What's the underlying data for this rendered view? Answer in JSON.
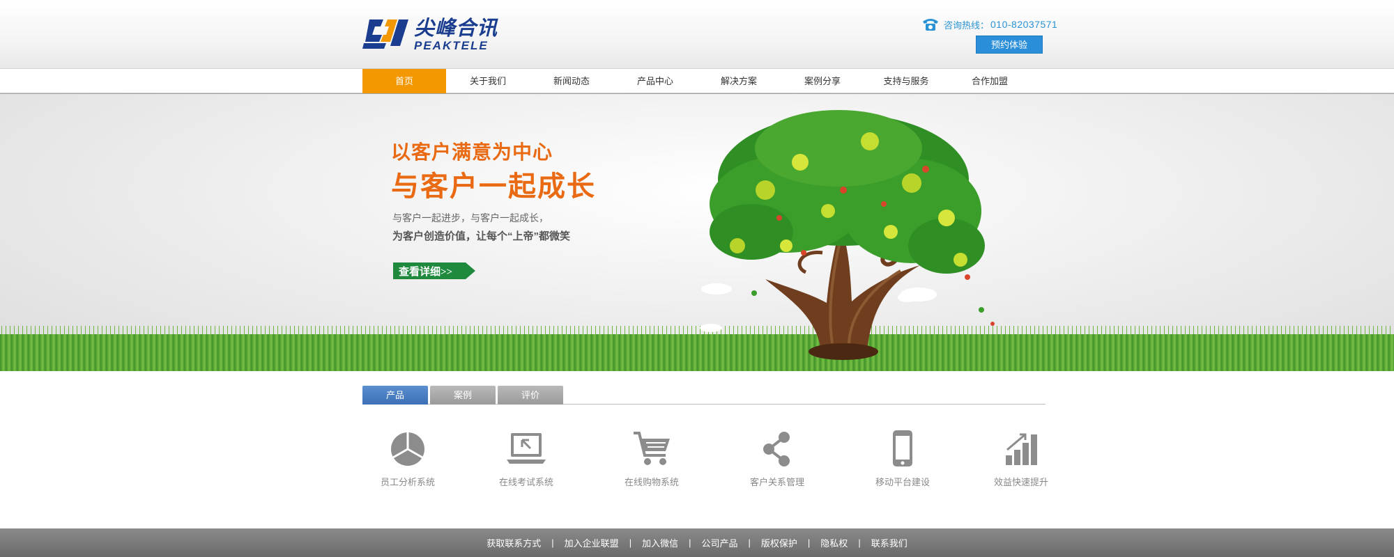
{
  "header": {
    "logo": {
      "name_cn": "尖峰合讯",
      "name_en": "PEAKTELE"
    },
    "hotline": {
      "label": "咨询热线：",
      "number": "010-82037571",
      "icon": "phone-icon"
    },
    "trial_button": "预约体验"
  },
  "nav": {
    "items": [
      {
        "label": "首页",
        "active": true
      },
      {
        "label": "关于我们"
      },
      {
        "label": "新闻动态"
      },
      {
        "label": "产品中心"
      },
      {
        "label": "解决方案"
      },
      {
        "label": "案例分享"
      },
      {
        "label": "支持与服务"
      },
      {
        "label": "合作加盟"
      }
    ]
  },
  "banner": {
    "slogan_line1": "以客户满意为中心",
    "slogan_line2": "与客户一起成长",
    "sub_line1": "与客户一起进步，与客户一起成长，",
    "sub_line2": "为客户创造价值，让每个“上帝”都微笑",
    "detail_button": "查看详细>>",
    "image": "tree-illustration"
  },
  "tabs": [
    {
      "label": "产品",
      "active": true
    },
    {
      "label": "案例"
    },
    {
      "label": "评价"
    }
  ],
  "products": [
    {
      "label": "员工分析系统",
      "icon": "pie-chart-icon"
    },
    {
      "label": "在线考试系统",
      "icon": "laptop-icon"
    },
    {
      "label": "在线购物系统",
      "icon": "shopping-cart-icon"
    },
    {
      "label": "客户关系管理",
      "icon": "share-icon"
    },
    {
      "label": "移动平台建设",
      "icon": "mobile-phone-icon"
    },
    {
      "label": "效益快速提升",
      "icon": "bar-growth-icon"
    }
  ],
  "footer": {
    "links": [
      "获取联系方式",
      "加入企业联盟",
      "加入微信",
      "公司产品",
      "版权保护",
      "隐私权",
      "联系我们"
    ],
    "separator": "|"
  },
  "colors": {
    "nav_active": "#f39800",
    "accent_blue": "#2a8fd8",
    "slogan_orange": "#e96a12",
    "logo_blue": "#1a3d8f",
    "tab_active": "#3c6fb4"
  }
}
